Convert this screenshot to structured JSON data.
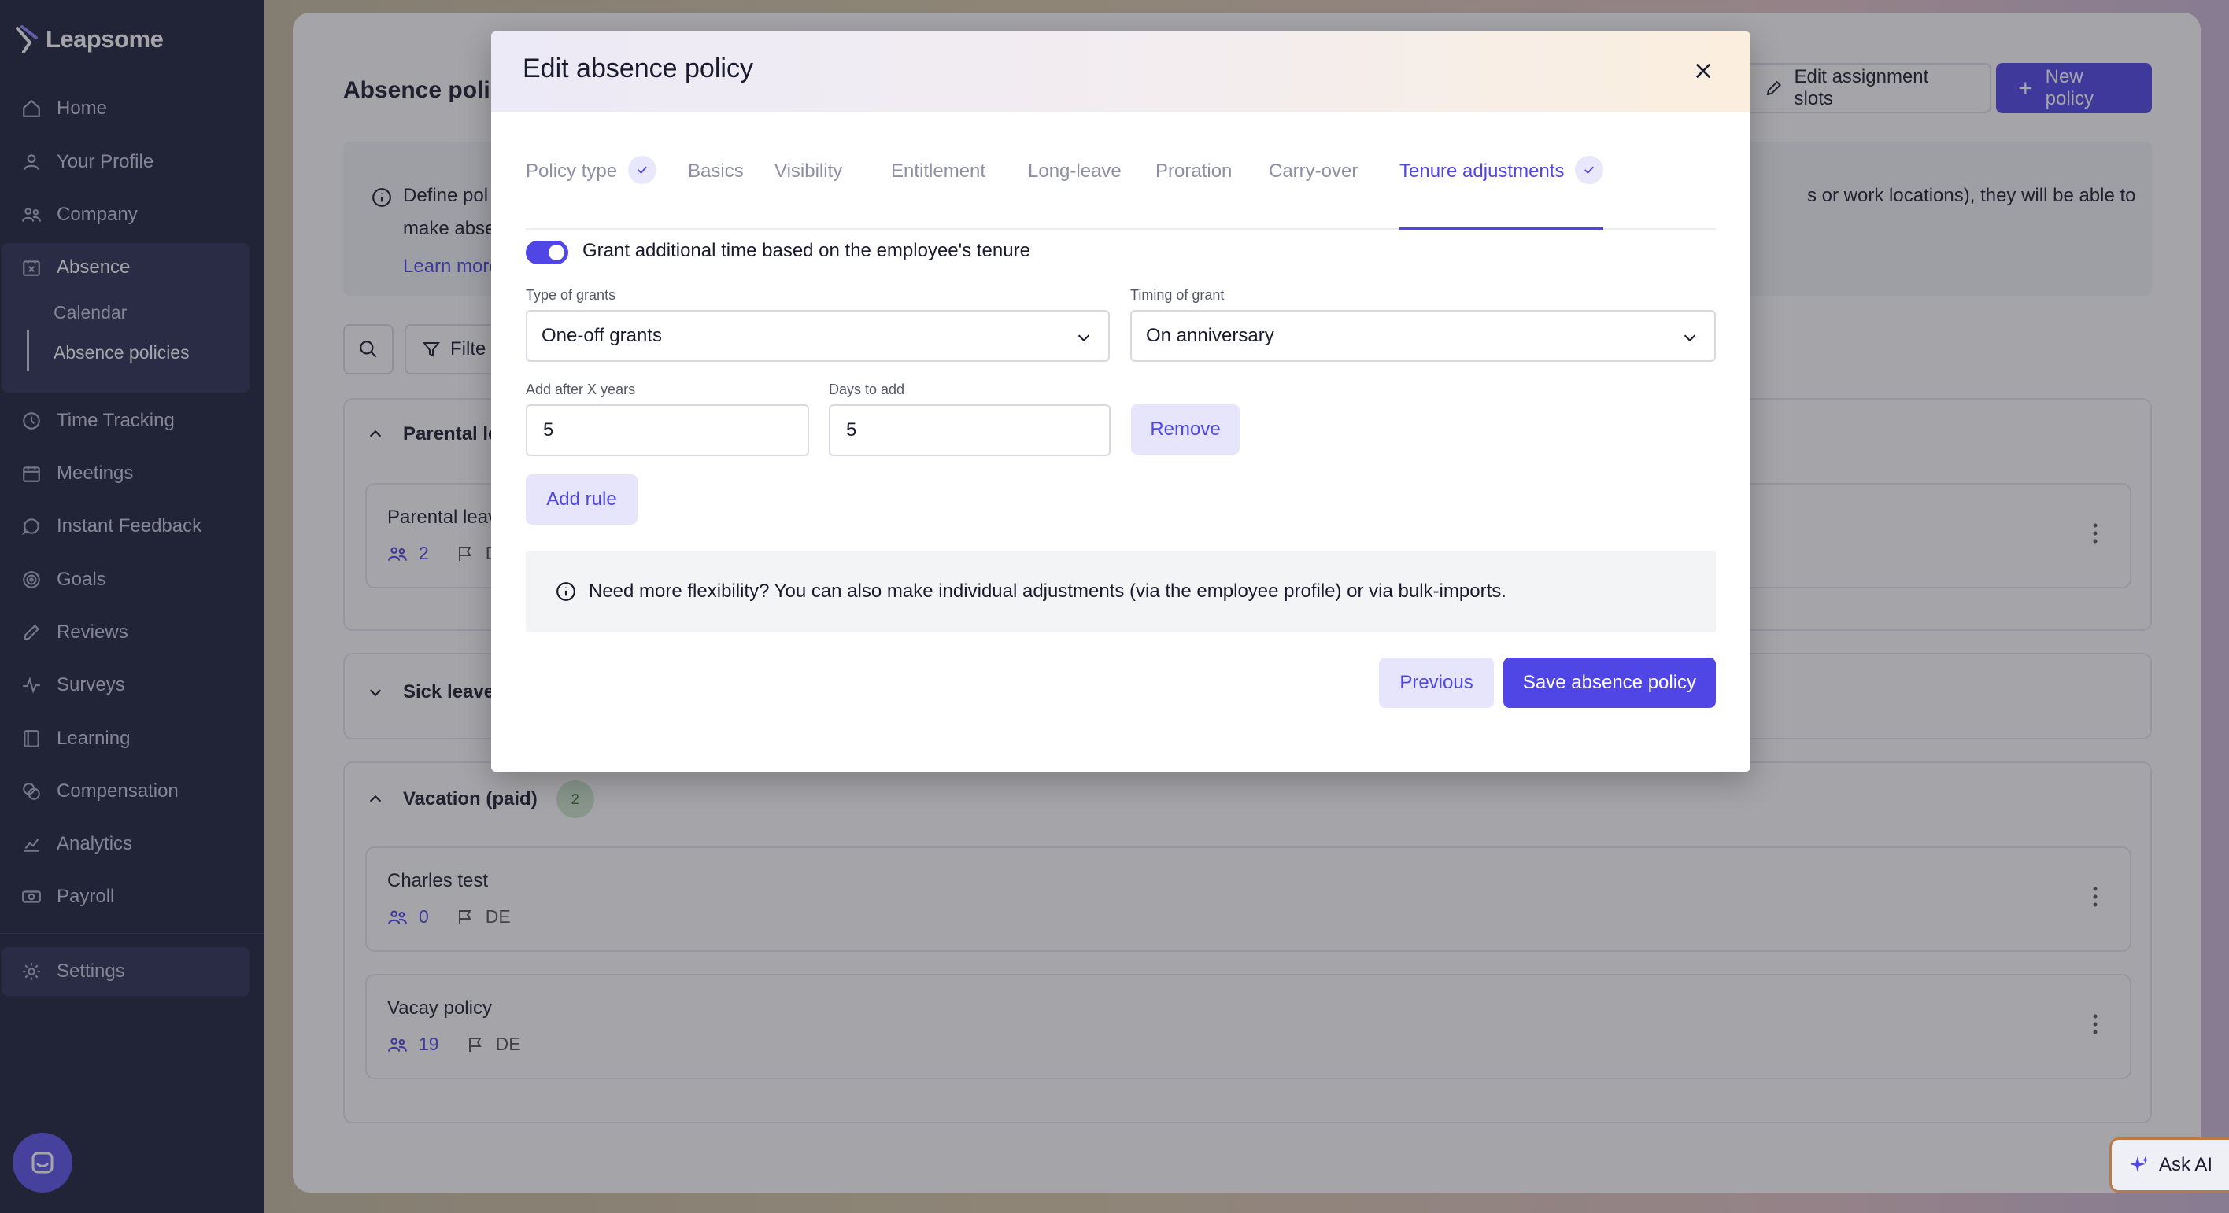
{
  "sidebar": {
    "logo": "Leapsome",
    "items": [
      {
        "label": "Home",
        "icon": "home-icon"
      },
      {
        "label": "Your Profile",
        "icon": "user-icon"
      },
      {
        "label": "Company",
        "icon": "users-icon"
      },
      {
        "label": "Absence",
        "icon": "calendar-x-icon"
      },
      {
        "label": "Time Tracking",
        "icon": "clock-icon"
      },
      {
        "label": "Meetings",
        "icon": "calendar-icon"
      },
      {
        "label": "Instant Feedback",
        "icon": "chat-icon"
      },
      {
        "label": "Goals",
        "icon": "target-icon"
      },
      {
        "label": "Reviews",
        "icon": "pencil-icon"
      },
      {
        "label": "Surveys",
        "icon": "pulse-icon"
      },
      {
        "label": "Learning",
        "icon": "book-icon"
      },
      {
        "label": "Compensation",
        "icon": "coins-icon"
      },
      {
        "label": "Analytics",
        "icon": "chart-icon"
      },
      {
        "label": "Payroll",
        "icon": "money-icon"
      },
      {
        "label": "Settings",
        "icon": "gear-icon"
      }
    ],
    "sub_items": [
      "Calendar",
      "Absence policies"
    ]
  },
  "main": {
    "title": "Absence polic",
    "edit_slots_label": "Edit assignment slots",
    "new_policy_label": "New policy",
    "banner_line1": "Define pol",
    "banner_line2": "make abse",
    "banner_right": "s or work locations), they will be able to",
    "banner_link": "Learn more",
    "filter_label": "Filte",
    "sections": [
      {
        "title": "Parental le",
        "expanded": true
      },
      {
        "title": "Sick leave",
        "expanded": false
      },
      {
        "title": "Vacation (paid)",
        "count": "2",
        "expanded": true
      }
    ],
    "cards": [
      {
        "name": "Parental leav",
        "count": "2",
        "region": "D"
      },
      {
        "name": "Charles test",
        "count": "0",
        "region": "DE"
      },
      {
        "name": "Vacay policy",
        "count": "19",
        "region": "DE"
      }
    ]
  },
  "ask_ai": "Ask AI",
  "modal": {
    "title": "Edit absence policy",
    "tabs": [
      {
        "label": "Policy type",
        "checked": true
      },
      {
        "label": "Basics"
      },
      {
        "label": "Visibility"
      },
      {
        "label": "Entitlement"
      },
      {
        "label": "Long-leave"
      },
      {
        "label": "Proration"
      },
      {
        "label": "Carry-over"
      },
      {
        "label": "Tenure adjustments",
        "checked": true,
        "active": true
      }
    ],
    "toggle_label": "Grant additional time based on the employee's tenure",
    "type_of_grants_label": "Type of grants",
    "type_of_grants_value": "One-off grants",
    "timing_label": "Timing of grant",
    "timing_value": "On anniversary",
    "add_after_label": "Add after X years",
    "add_after_value": "5",
    "days_label": "Days to add",
    "days_value": "5",
    "remove_label": "Remove",
    "add_rule_label": "Add rule",
    "note": "Need more flexibility? You can also make individual adjustments (via the employee profile) or via bulk-imports.",
    "previous_label": "Previous",
    "save_label": "Save absence policy"
  },
  "colors": {
    "accent": "#4f46e5",
    "sidebar_bg": "#1c1f3a"
  }
}
